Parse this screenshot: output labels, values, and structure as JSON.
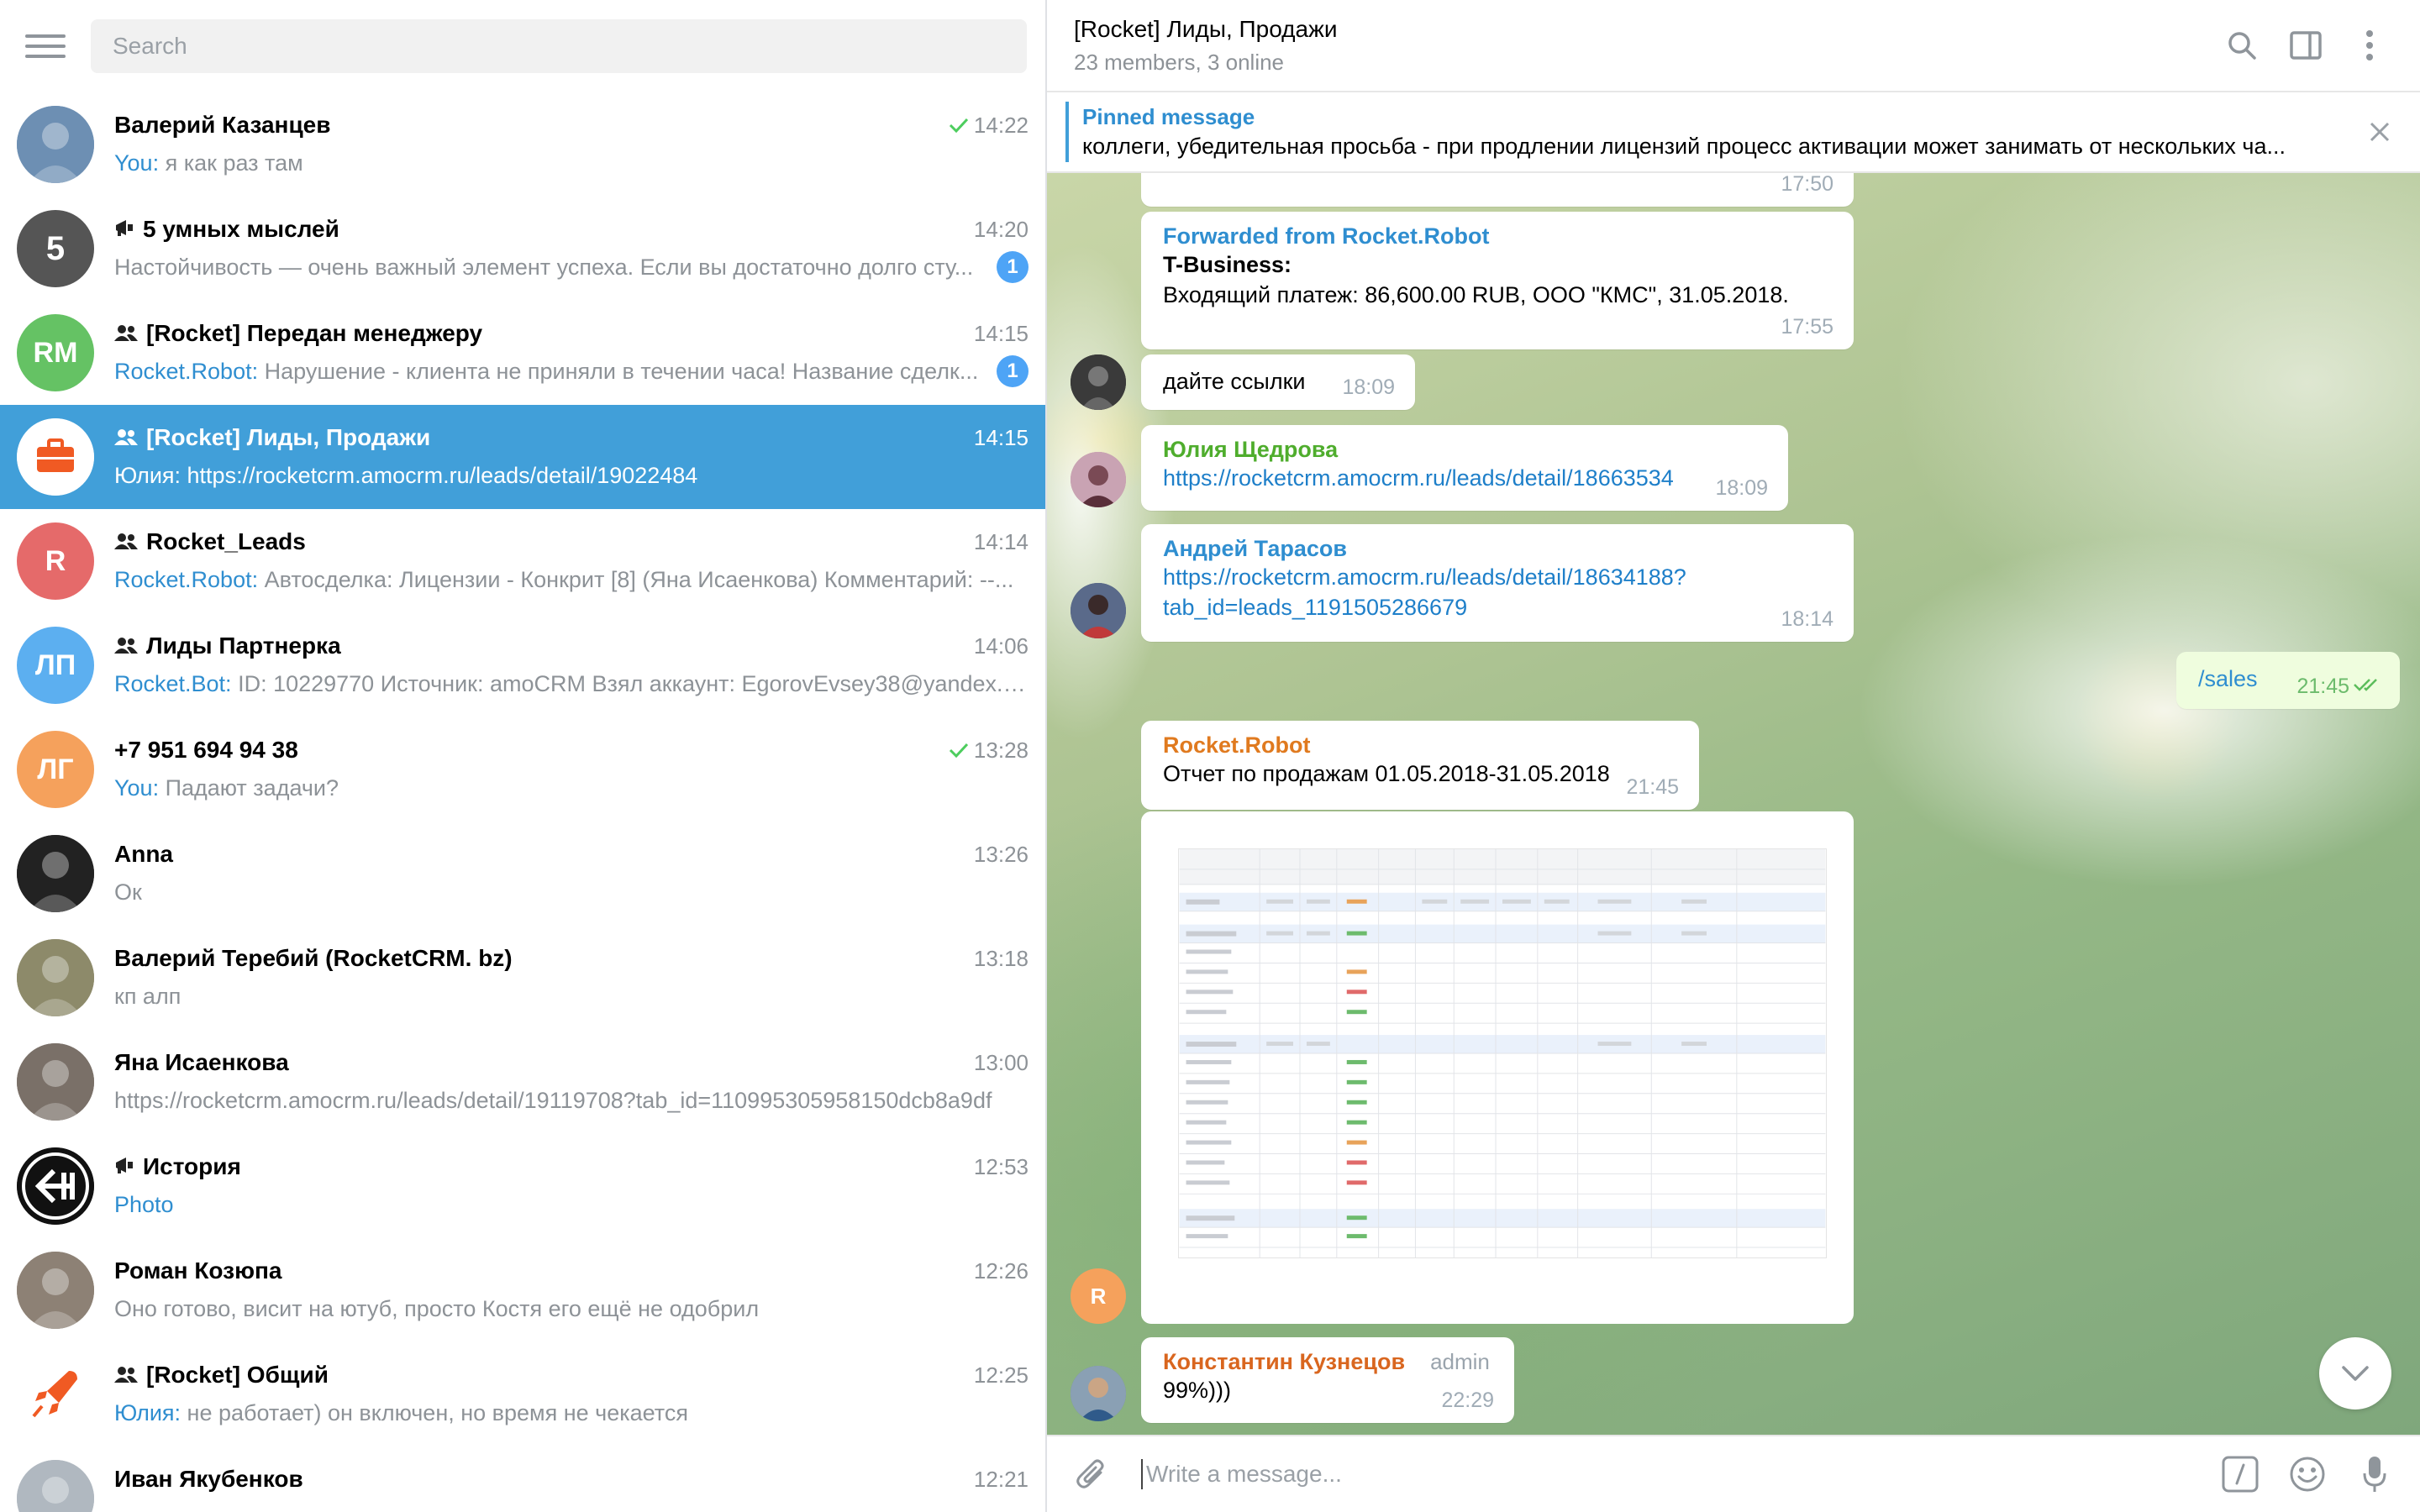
{
  "search": {
    "placeholder": "Search"
  },
  "chats": [
    {
      "title": "Валерий Казанцев",
      "type": "user",
      "time": "14:22",
      "read": true,
      "sender": "You:",
      "preview": " я как раз там",
      "badge": "",
      "avatar_color": "#6d8fb3",
      "initials": ""
    },
    {
      "title": "5 умных мыслей",
      "type": "channel",
      "time": "14:20",
      "read": false,
      "sender": "",
      "preview": "Настойчивость — очень важный элемент успеха. Если вы достаточно долго сту...",
      "badge": "1",
      "avatar_color": "#555555",
      "initials": "5"
    },
    {
      "title": "[Rocket] Передан менеджеру",
      "type": "group",
      "time": "14:15",
      "read": false,
      "sender": "Rocket.Robot:",
      "preview": " Нарушение - клиента не приняли в течении часа! Название сделк...",
      "badge": "1",
      "avatar_color": "#65c264",
      "initials": "RM"
    },
    {
      "title": "[Rocket] Лиды, Продажи",
      "type": "group",
      "time": "14:15",
      "read": false,
      "sender": "Юлия:",
      "preview": " https://rocketcrm.amocrm.ru/leads/detail/19022484",
      "badge": "",
      "avatar_color": "#ffffff",
      "initials": ""
    },
    {
      "title": "Rocket_Leads",
      "type": "group",
      "time": "14:14",
      "read": false,
      "sender": "Rocket.Robot:",
      "preview": " Автосделка: Лицензии - Конкрит [8] (Яна Исаенкова)  Комментарий:  --...",
      "badge": "",
      "avatar_color": "#e56a6a",
      "initials": "R"
    },
    {
      "title": "Лиды Партнерка",
      "type": "group",
      "time": "14:06",
      "read": false,
      "sender": "Rocket.Bot:",
      "preview": " ID: 10229770 Источник: amoCRM Взял аккаунт: EgorovEvsey38@yandex.ru...",
      "badge": "",
      "avatar_color": "#5caff0",
      "initials": "ЛП"
    },
    {
      "title": "+7 951 694 94 38",
      "type": "user",
      "time": "13:28",
      "read": true,
      "sender": "You:",
      "preview": " Падают задачи?",
      "badge": "",
      "avatar_color": "#f5a15c",
      "initials": "ЛГ"
    },
    {
      "title": "Anna",
      "type": "user",
      "time": "13:26",
      "read": false,
      "sender": "",
      "preview": "Ок",
      "badge": "",
      "avatar_color": "#222222",
      "initials": ""
    },
    {
      "title": "Валерий Теребий (RocketCRM. bz)",
      "type": "user",
      "time": "13:18",
      "read": false,
      "sender": "",
      "preview": "кп алп",
      "badge": "",
      "avatar_color": "#8d8a6a",
      "initials": ""
    },
    {
      "title": "Яна Исаенкова",
      "type": "user",
      "time": "13:00",
      "read": false,
      "sender": "",
      "preview": "https://rocketcrm.amocrm.ru/leads/detail/19119708?tab_id=110995305958150dcb8a9df",
      "badge": "",
      "avatar_color": "#7a7068",
      "initials": ""
    },
    {
      "title": "История",
      "type": "channel",
      "time": "12:53",
      "read": false,
      "sender": "Photo",
      "preview": "",
      "badge": "",
      "avatar_color": "#111111",
      "initials": ""
    },
    {
      "title": "Роман Козюпа",
      "type": "user",
      "time": "12:26",
      "read": false,
      "sender": "",
      "preview": "Оно готово, висит на ютуб, просто Костя его ещё не одобрил",
      "badge": "",
      "avatar_color": "#8d8175",
      "initials": ""
    },
    {
      "title": "[Rocket] Общий",
      "type": "group",
      "time": "12:25",
      "read": false,
      "sender": "Юлия:",
      "preview": " не работает) он включен, но время не чекается",
      "badge": "",
      "avatar_color": "#ffffff",
      "initials": ""
    },
    {
      "title": "Иван Якубенков",
      "type": "user",
      "time": "12:21",
      "read": false,
      "sender": "",
      "preview": "",
      "badge": "",
      "avatar_color": "#b0b8c0",
      "initials": ""
    }
  ],
  "header": {
    "title": "[Rocket] Лиды, Продажи",
    "subtitle": "23 members, 3 online"
  },
  "pinned": {
    "label": "Pinned message",
    "text": "коллеги, убедительная просьба - при продлении лицензий процесс активации может занимать от нескольких ча..."
  },
  "messages": {
    "m0_time": "17:50",
    "fwd_label": "Forwarded from Rocket.Robot",
    "fwd_bold": "T-Business:",
    "fwd_text": "Входящий платеж: 86,600.00 RUB, ООО \"КМС\", 31.05.2018.",
    "fwd_time": "17:55",
    "m2_text": "дайте ссылки",
    "m2_time": "18:09",
    "m3_sender": "Юлия Щедрова",
    "m3_link": "https://rocketcrm.amocrm.ru/leads/detail/18663534",
    "m3_time": "18:09",
    "m4_sender": "Андрей Тарасов",
    "m4_link1": "https://rocketcrm.amocrm.ru/leads/detail/18634188?",
    "m4_link2": "tab_id=leads_1191505286679",
    "m4_time": "18:14",
    "out_text": "/sales",
    "out_time": "21:45",
    "m6_sender": "Rocket.Robot",
    "m6_text": "Отчет по продажам 01.05.2018-31.05.2018",
    "m6_time": "21:45",
    "m6_avatar": "R",
    "m7_sender": "Константин Кузнецов",
    "m7_role": "admin",
    "m7_text": "99%)))",
    "m7_time": "22:29"
  },
  "composer": {
    "placeholder": "Write a message..."
  }
}
